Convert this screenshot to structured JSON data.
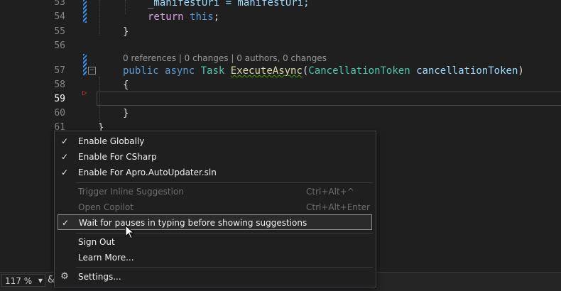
{
  "editor": {
    "lines": [
      {
        "num": "53",
        "text_parts": [
          "_manifestUri = manifestUri;"
        ]
      },
      {
        "num": "54",
        "kw": "return",
        "kw_rest": " this;"
      },
      {
        "num": "55",
        "text": "}"
      },
      {
        "num": "56",
        "text": ""
      },
      {
        "num": "57"
      },
      {
        "num": "58",
        "text": "{"
      },
      {
        "num": "59",
        "text": ""
      },
      {
        "num": "60",
        "text": "}"
      },
      {
        "num": "61",
        "text": "}"
      }
    ],
    "codelens": "0 references | 0 changes | 0 authors, 0 changes",
    "sig": {
      "public": "public",
      "async": "async",
      "task": "Task",
      "method": "ExecuteAsync",
      "open": "(",
      "param_type": "CancellationToken",
      "param_name": "cancellationToken",
      "close": ")"
    },
    "line53": "_manifestUri = manifestUri;",
    "line54_kw": "return",
    "line54_this": "this",
    "line54_semi": ";"
  },
  "statusbar": {
    "zoom": "117 %"
  },
  "menu": {
    "items": [
      {
        "label": "Enable Globally",
        "checked": "✓",
        "shortcut": ""
      },
      {
        "label": "Enable For CSharp",
        "checked": "✓",
        "shortcut": ""
      },
      {
        "label": "Enable For Apro.AutoUpdater.sln",
        "checked": "✓",
        "shortcut": ""
      },
      {
        "label": "Trigger Inline Suggestion",
        "checked": "",
        "shortcut": "Ctrl+Alt+^"
      },
      {
        "label": "Open Copilot",
        "checked": "",
        "shortcut": "Ctrl+Alt+Enter"
      },
      {
        "label": "Wait for pauses in typing before showing suggestions",
        "checked": "✓",
        "shortcut": ""
      },
      {
        "label": "Sign Out",
        "checked": "",
        "shortcut": ""
      },
      {
        "label": "Learn More...",
        "checked": "",
        "shortcut": ""
      },
      {
        "label": "Settings...",
        "checked": "",
        "shortcut": ""
      }
    ]
  },
  "colors": {
    "keyword": "#569cd6",
    "control_keyword": "#d8a0df",
    "type": "#4ec9b0",
    "method": "#dcdcaa",
    "parameter": "#9cdcfe",
    "menu_bg": "#1f1f1f",
    "accent_git": "#3794ff"
  },
  "icons": {
    "check": "check-icon",
    "gear": "gear-icon",
    "copilot": "copilot-icon",
    "breakpoint": "breakpoint-arrow-icon",
    "collapse": "collapse-icon"
  }
}
